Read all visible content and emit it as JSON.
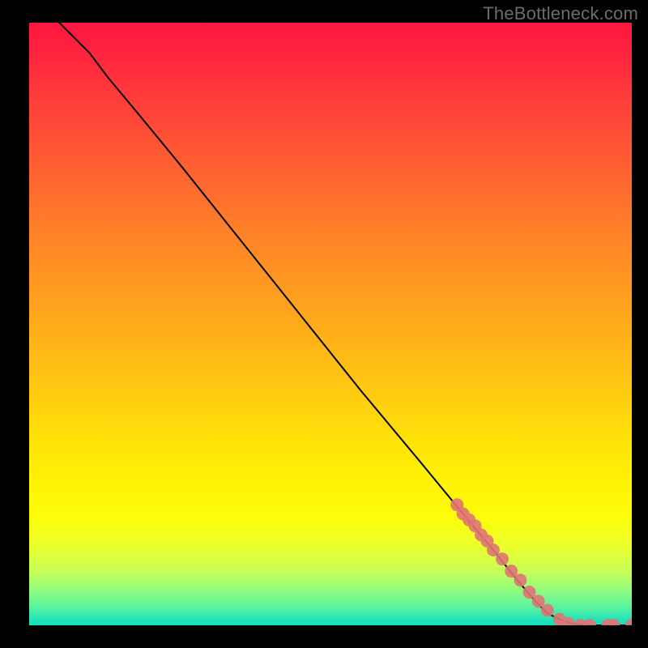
{
  "watermark": "TheBottleneck.com",
  "chart_data": {
    "type": "line",
    "title": "",
    "xlabel": "",
    "ylabel": "",
    "xlim": [
      0,
      100
    ],
    "ylim": [
      0,
      100
    ],
    "x_axis_visible": false,
    "y_axis_visible": false,
    "background": "red-yellow-green vertical gradient",
    "series": [
      {
        "name": "main-curve",
        "type": "line",
        "color": "#000000",
        "x": [
          5,
          7,
          10,
          13,
          18,
          25,
          35,
          45,
          55,
          65,
          72,
          77,
          81,
          84,
          86,
          88,
          90,
          92,
          95,
          98,
          100
        ],
        "y": [
          100,
          98,
          95,
          91,
          85,
          76.5,
          64,
          51.5,
          39,
          27,
          18.5,
          12.5,
          7.5,
          4,
          2,
          1,
          0.3,
          0,
          0,
          0,
          0
        ]
      },
      {
        "name": "point-cluster",
        "type": "scatter",
        "color": "#e07474",
        "x": [
          71,
          72,
          73,
          74,
          75,
          76,
          77,
          78.5,
          80,
          81.5,
          83,
          84.5,
          86,
          88,
          89.5,
          91.5,
          93,
          96,
          97,
          100
        ],
        "y": [
          20,
          18.5,
          17.5,
          16.5,
          15,
          14,
          12.5,
          11,
          9,
          7.5,
          5.5,
          4,
          2.5,
          1,
          0.3,
          0,
          0,
          0,
          0,
          0
        ]
      }
    ]
  }
}
